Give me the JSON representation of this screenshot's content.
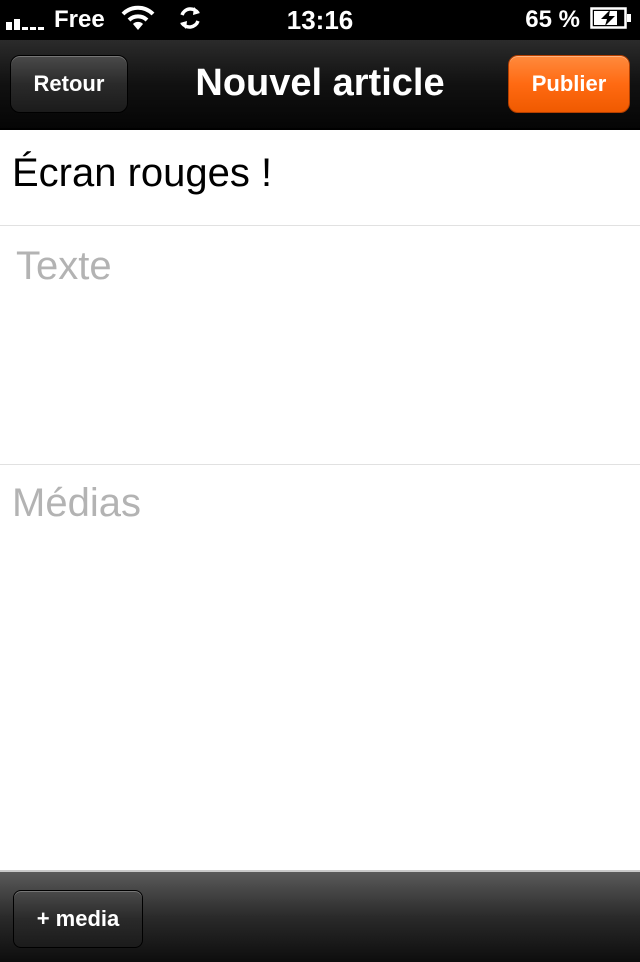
{
  "status_bar": {
    "carrier": "Free",
    "time": "13:16",
    "battery_percent": "65 %",
    "icons": [
      "signal-icon",
      "wifi-icon",
      "sync-icon",
      "battery-charging-icon"
    ]
  },
  "nav_bar": {
    "back_label": "Retour",
    "title": "Nouvel article",
    "publish_label": "Publier",
    "publish_color": "#ff6a12"
  },
  "form": {
    "title_value": "Écran rouges !",
    "text_placeholder": "Texte",
    "media_placeholder": "Médias"
  },
  "toolbar": {
    "add_media_label": "+ media"
  }
}
